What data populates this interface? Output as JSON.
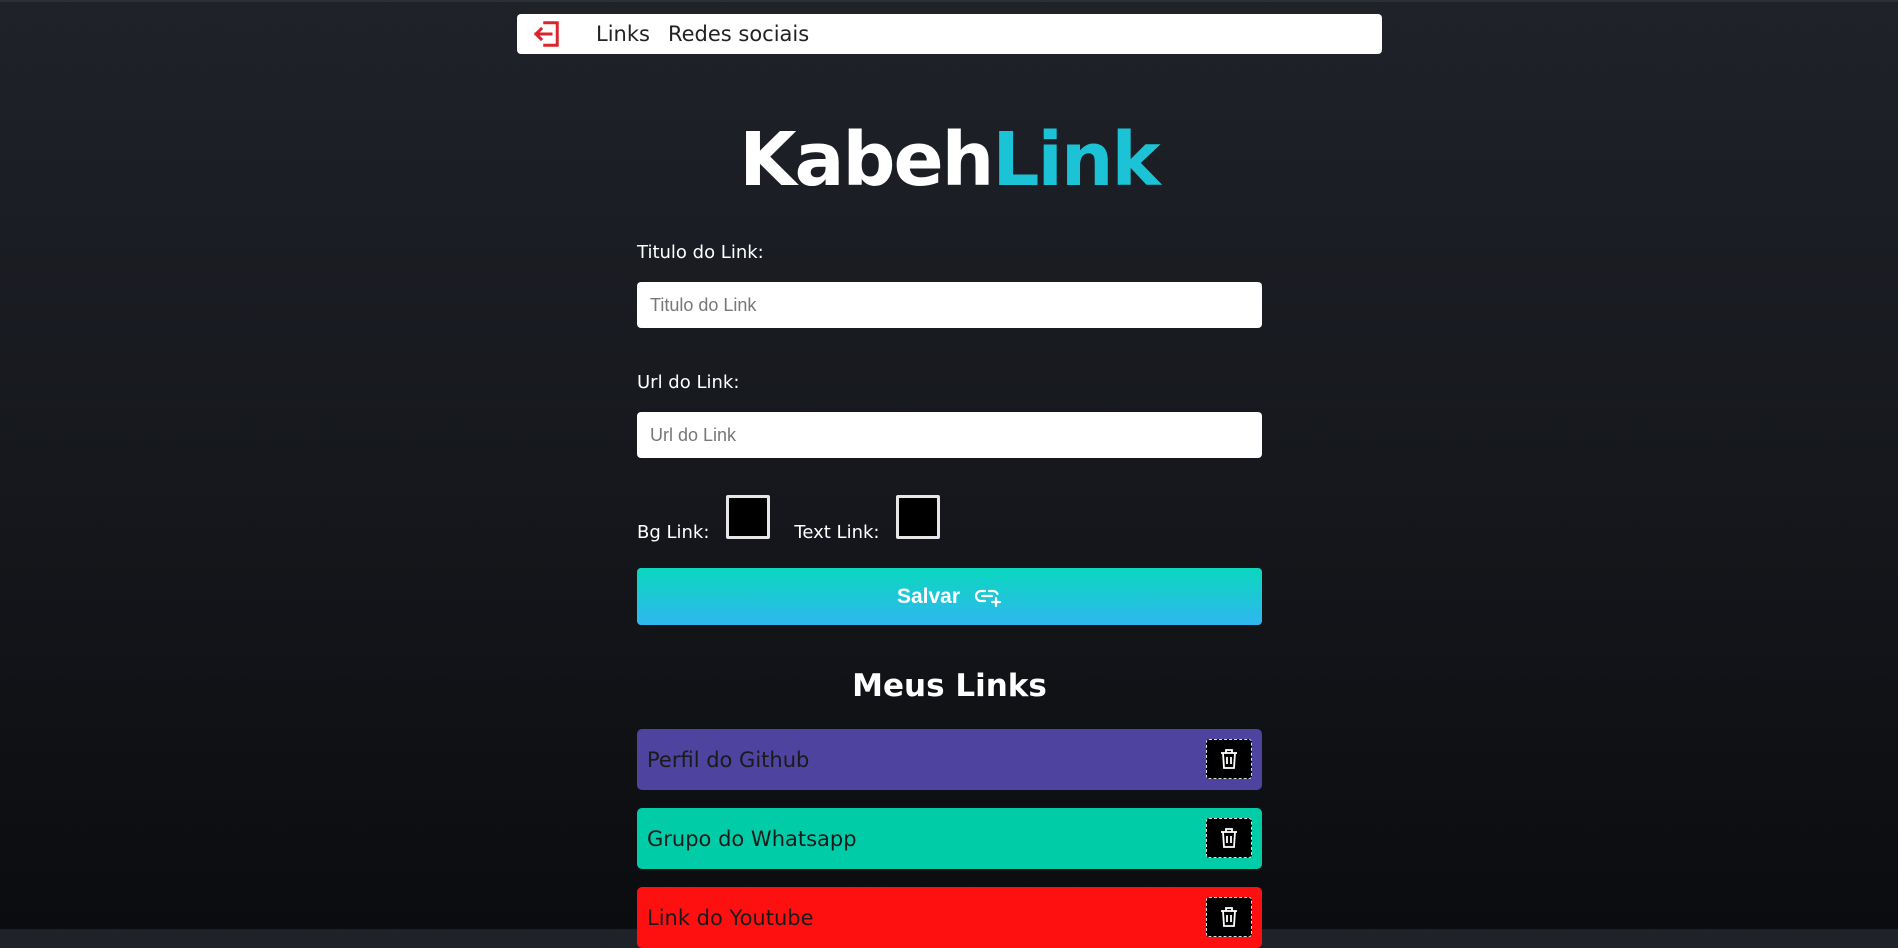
{
  "navbar": {
    "logout_icon": "logout-icon",
    "links_label": "Links",
    "social_label": "Redes sociais"
  },
  "logo": {
    "part1": "Kabeh",
    "part2": "Link",
    "accent_color": "#1cc3d6"
  },
  "form": {
    "title_label": "Titulo do Link:",
    "title_placeholder": "Titulo do Link",
    "url_label": "Url do Link:",
    "url_placeholder": "Url do Link",
    "bg_label": "Bg Link:",
    "bg_color": "#000000",
    "text_label": "Text Link:",
    "text_color": "#000000",
    "save_label": "Salvar",
    "save_icon": "link-add-icon"
  },
  "links_section": {
    "title": "Meus Links",
    "items": [
      {
        "name": "Perfil do Github",
        "bg": "#4f43a0",
        "color": "#1a1a1a"
      },
      {
        "name": "Grupo do Whatsapp",
        "bg": "#00cca8",
        "color": "#1a1a1a"
      },
      {
        "name": "Link do Youtube",
        "bg": "#ff1010",
        "color": "#1a1a1a"
      }
    ],
    "delete_icon": "trash-icon"
  }
}
